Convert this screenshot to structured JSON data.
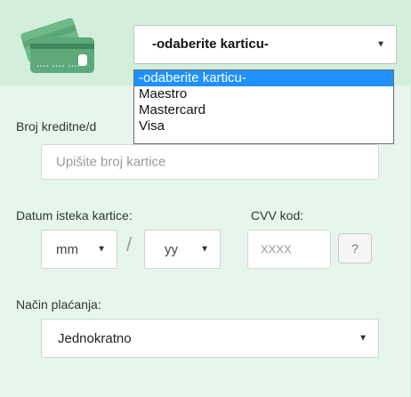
{
  "card_select": {
    "value": "-odaberite karticu-",
    "options": [
      "-odaberite karticu-",
      "Maestro",
      "Mastercard",
      "Visa"
    ],
    "highlighted_index": 0
  },
  "card_number": {
    "label": "Broj kreditne/d",
    "placeholder": "Upišite broj kartice"
  },
  "expiry": {
    "label": "Datum isteka kartice:",
    "month_value": "mm",
    "separator": "/",
    "year_value": "yy"
  },
  "cvv": {
    "label": "CVV kod:",
    "placeholder": "XXXX",
    "help_label": "?"
  },
  "payment_method": {
    "label": "Način plaćanja:",
    "value": "Jednokratno"
  },
  "icons": {
    "card": "credit-card-icon",
    "dropdown_arrow": "dropdown-arrow-icon"
  },
  "colors": {
    "panel_background": "#e6f6ec",
    "highlight": "#1e90ff"
  }
}
